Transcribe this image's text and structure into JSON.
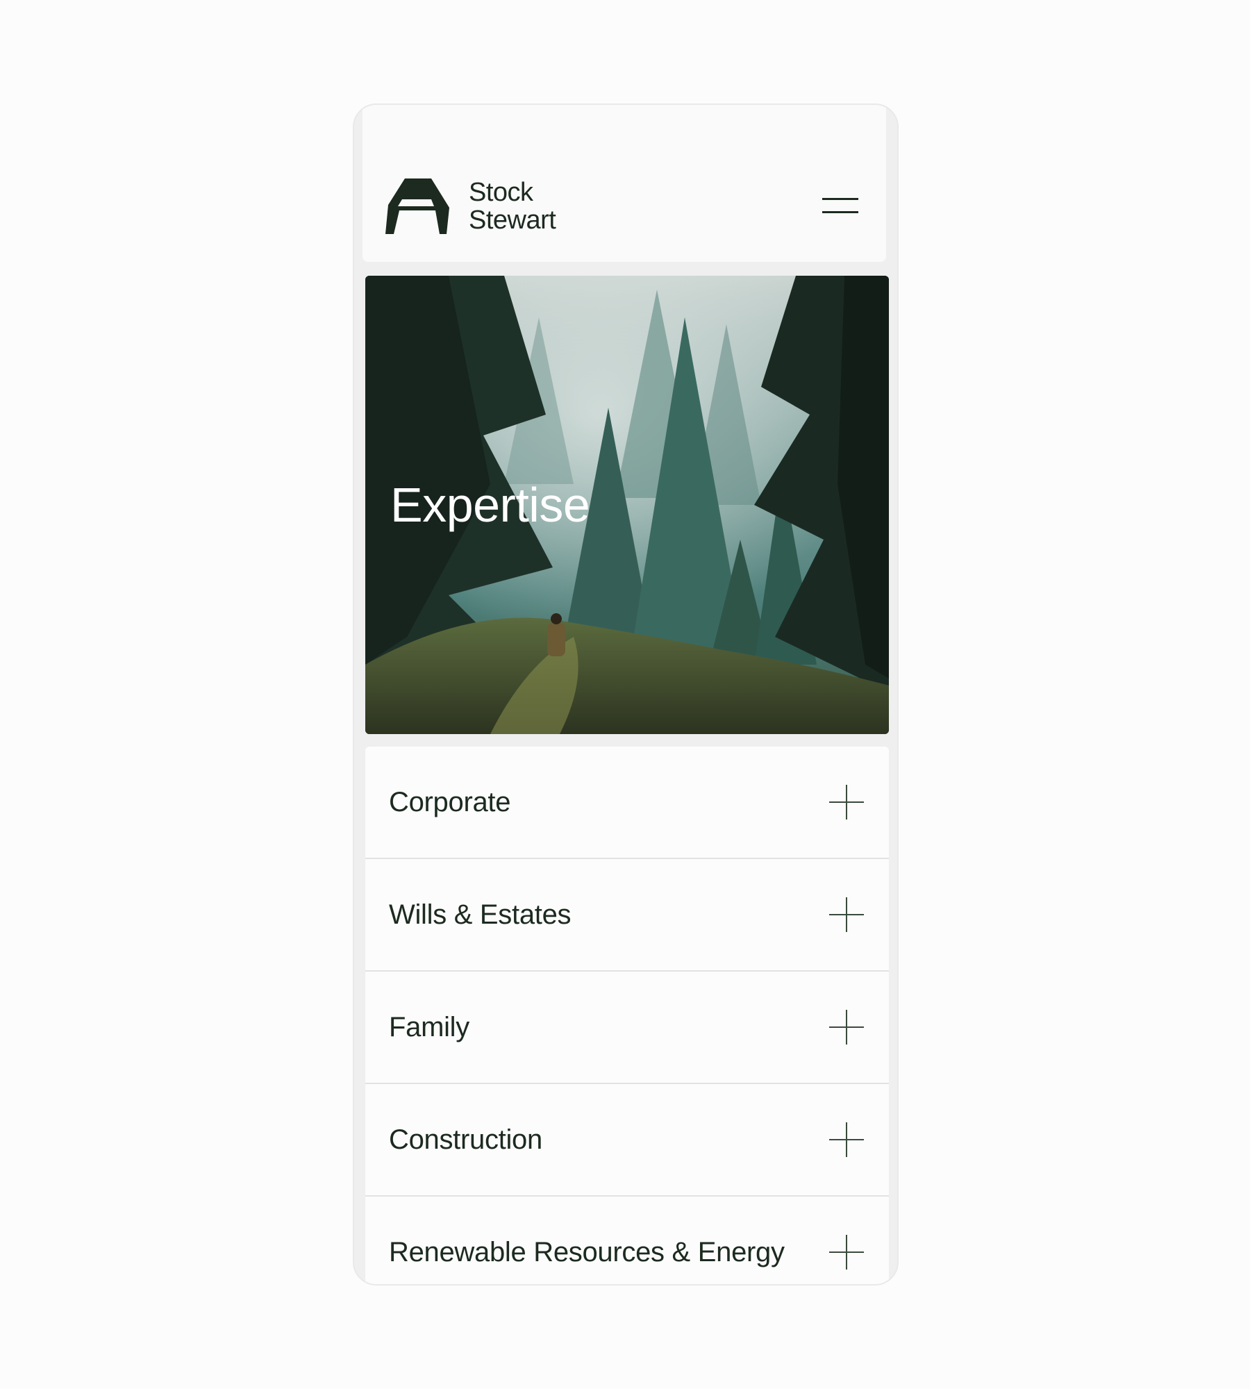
{
  "brand": {
    "name_line1": "Stock",
    "name_line2": "Stewart",
    "logo_icon": "arch-logo-icon"
  },
  "header": {
    "menu_icon": "hamburger-menu-icon"
  },
  "hero": {
    "title": "Expertise",
    "image": "misty-forest-with-hiker"
  },
  "accordion": {
    "items": [
      {
        "label": "Corporate",
        "icon": "plus-icon",
        "expanded": false
      },
      {
        "label": "Wills & Estates",
        "icon": "plus-icon",
        "expanded": false
      },
      {
        "label": "Family",
        "icon": "plus-icon",
        "expanded": false
      },
      {
        "label": "Construction",
        "icon": "plus-icon",
        "expanded": false
      },
      {
        "label": "Renewable Resources & Energy",
        "icon": "plus-icon",
        "expanded": false
      }
    ]
  },
  "colors": {
    "ink": "#1c2a1f",
    "page_bg": "#fcfcfc",
    "frame_bg": "#efefef",
    "hero_teal": "#4d7a77",
    "forest_dark": "#1a2a22"
  }
}
